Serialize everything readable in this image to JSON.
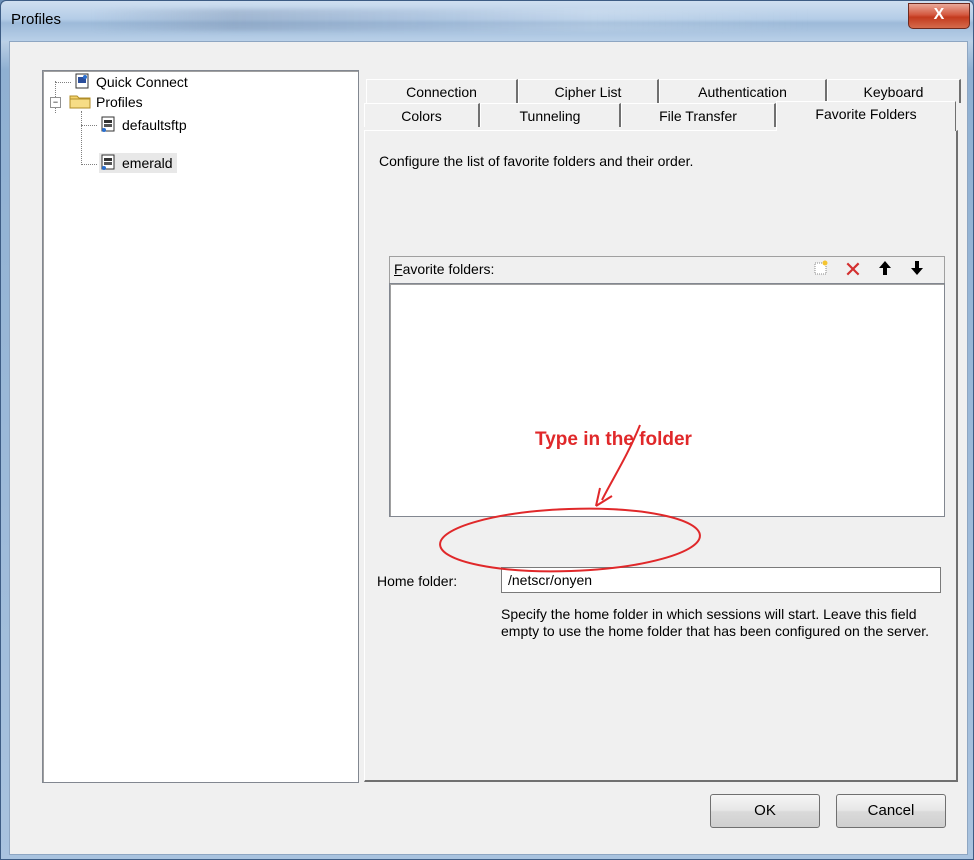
{
  "window": {
    "title": "Profiles",
    "close_glyph": "X"
  },
  "tree": {
    "items": [
      {
        "label": "Quick Connect",
        "icon": "session-icon"
      },
      {
        "label": "Profiles",
        "icon": "folder-icon",
        "expander": "−"
      },
      {
        "label": "defaultsftp",
        "icon": "profile-icon"
      },
      {
        "label": "emerald",
        "icon": "profile-icon"
      }
    ]
  },
  "tabs": {
    "row1": [
      "Connection",
      "Cipher List",
      "Authentication",
      "Keyboard"
    ],
    "row2": [
      "Colors",
      "Tunneling",
      "File Transfer",
      "Favorite Folders"
    ],
    "active": "Favorite Folders"
  },
  "panel": {
    "description": "Configure the list of favorite folders and their order.",
    "favorites_label_first": "F",
    "favorites_label_rest": "avorite folders:",
    "toolbar_icons": [
      "new-folder-icon",
      "delete-icon",
      "move-up-icon",
      "move-down-icon"
    ],
    "home_label": "Home folder:",
    "home_value": "/netscr/onyen",
    "help": "Specify the home folder in which sessions will start. Leave this field empty to use the home folder that has been configured on the server."
  },
  "annotation": {
    "text": "Type in the folder",
    "color": "#e0282a"
  },
  "buttons": {
    "ok": "OK",
    "cancel": "Cancel"
  }
}
